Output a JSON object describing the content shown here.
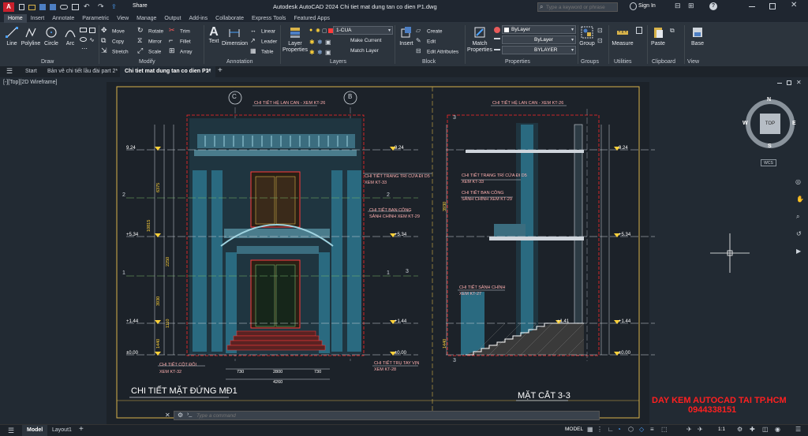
{
  "titlebar": {
    "app_badge": "A",
    "share": "Share",
    "title": "Autodesk AutoCAD 2024    Chi tiet mat dung tan co dien P1.dwg",
    "search_placeholder": "Type a keyword or phrase",
    "sign_in": "Sign In"
  },
  "ribbon_tabs": [
    "Home",
    "Insert",
    "Annotate",
    "Parametric",
    "View",
    "Manage",
    "Output",
    "Add-ins",
    "Collaborate",
    "Express Tools",
    "Featured Apps"
  ],
  "ribbon": {
    "draw": {
      "name": "Draw",
      "line": "Line",
      "polyline": "Polyline",
      "circle": "Circle",
      "arc": "Arc"
    },
    "modify": {
      "name": "Modify",
      "move": "Move",
      "rotate": "Rotate",
      "trim": "Trim",
      "copy": "Copy",
      "mirror": "Mirror",
      "fillet": "Fillet",
      "stretch": "Stretch",
      "scale": "Scale",
      "array": "Array"
    },
    "annotation": {
      "name": "Annotation",
      "text": "Text",
      "dimension": "Dimension",
      "linear": "Linear",
      "leader": "Leader",
      "table": "Table"
    },
    "layers": {
      "name": "Layers",
      "layer_properties_1": "Layer",
      "layer_properties_2": "Properties",
      "current_layer": "1-CUA",
      "make_current": "Make Current",
      "match_layer": "Match Layer"
    },
    "block": {
      "name": "Block",
      "insert": "Insert",
      "create": "Create",
      "edit": "Edit",
      "edit_attributes": "Edit Attributes"
    },
    "properties": {
      "name": "Properties",
      "match_1": "Match",
      "match_2": "Properties",
      "color": "ByLayer",
      "linetype": "ByLayer",
      "lineweight": "BYLAYER"
    },
    "groups": {
      "name": "Groups",
      "group": "Group"
    },
    "utilities": {
      "name": "Utilities",
      "measure": "Measure"
    },
    "clipboard": {
      "name": "Clipboard",
      "paste": "Paste"
    },
    "view": {
      "name": "View",
      "base": "Base"
    }
  },
  "doc_tabs": {
    "start": "Start",
    "tab1": "Bản vẽ chi tiết lầu đài part 2*",
    "tab2": "Chi tiet mat dung tan co dien P1*"
  },
  "viewport_label": "[-][Top][2D Wireframe]",
  "viewcube": {
    "n": "N",
    "s": "S",
    "e": "E",
    "w": "W",
    "top": "TOP",
    "wcs": "WCS"
  },
  "drawing": {
    "grid_c": "C",
    "grid_b": "B",
    "grid_2": "2",
    "grid_1": "1",
    "grid_3": "3",
    "note_lancan_left": "CHI TIẾT HỆ LAN CAN - XEM KT-26",
    "note_lancan_right": "CHI TIẾT HỆ LAN CAN - XEM KT-26",
    "note_trangtri_1": "CHI TIẾT TRANG TRÍ CỬA ĐI D5",
    "note_trangtri_2": "XEM KT-33",
    "note_bancong_1": "CHI TIẾT BAN CÔNG",
    "note_bancong_2": "SẢNH CHÍNH XEM KT-29",
    "note_cotdoi_1": "CHI TIẾT CỘT ĐÔI",
    "note_cotdoi_2": "XEM KT-32",
    "note_tru_1": "CHI TIẾT TRỤ TAY VỊN",
    "note_tru_2": "XEM KT-28",
    "note_sanh_1": "CHI TIẾT SẢNH CHÍNH",
    "note_sanh_2": "XEM KT-27",
    "r_trangtri_1": "CHI TIẾT TRANG TRÍ CỬA ĐI D5",
    "r_trangtri_2": "XEM KT-33",
    "r_bancong_1": "CHI TIẾT BAN CÔNG",
    "r_bancong_2": "SẢNH CHÍNH XEM KT-29",
    "lv_924": "9.24",
    "lv_534": "+5.34",
    "lv_144": "+1.44",
    "lv_000": "±0.00",
    "lv_141": "+1.41",
    "dim_10815": "10815",
    "dim_6375": "6375",
    "dim_3930": "3930",
    "dim_1440": "1440",
    "dim_2250": "2250",
    "dim_1110": "1110",
    "dim_730a": "730",
    "dim_2800": "2800",
    "dim_730b": "730",
    "dim_4260": "4260",
    "title_left": "CHI TIẾT MẶT ĐỨNG MĐ1",
    "title_right": "MẶT CẮT 3-3",
    "dim_6900": "6900",
    "promo_1": "DAY KEM AUTOCAD TAI TP.HCM",
    "promo_2": "0944338151"
  },
  "command_placeholder": "Type a command",
  "status": {
    "model": "Model",
    "layout1": "Layout1",
    "model_btn": "MODEL",
    "scale": "1:1"
  }
}
